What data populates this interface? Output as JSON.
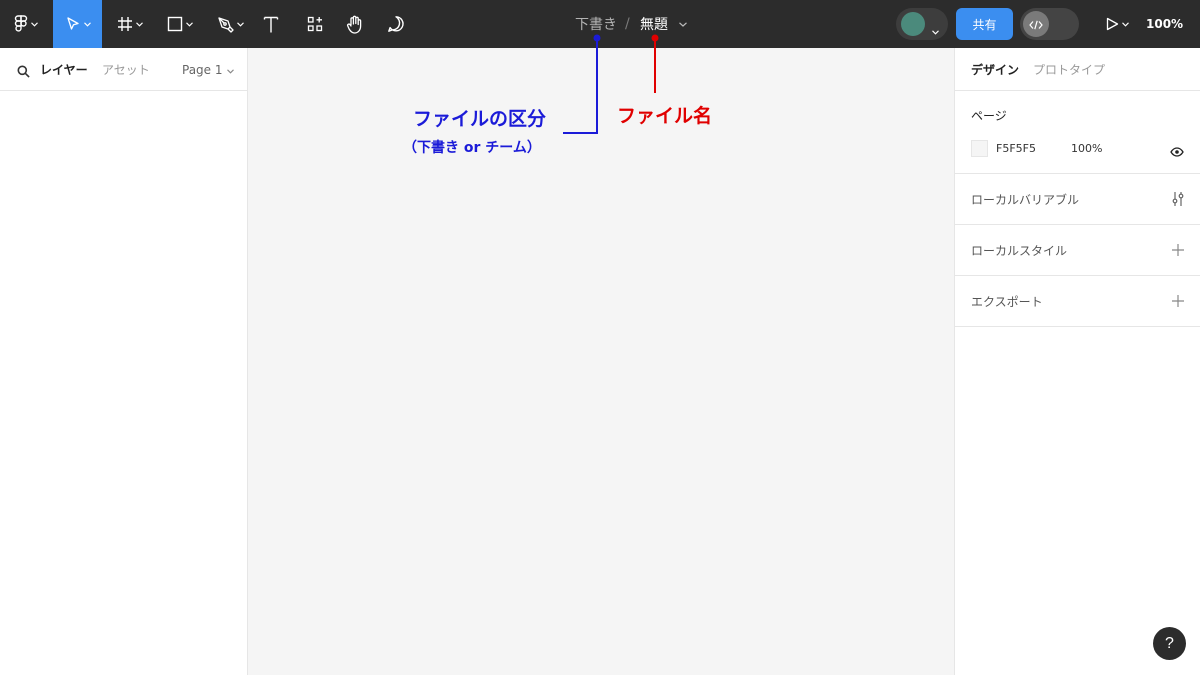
{
  "toolbar": {
    "breadcrumb_draft": "下書き",
    "breadcrumb_separator": "/",
    "file_name": "無題",
    "share_label": "共有",
    "zoom_label": "100%",
    "tool_icons": [
      "figma-menu-icon",
      "move-tool-icon",
      "frame-tool-icon",
      "rectangle-tool-icon",
      "pen-tool-icon",
      "text-tool-icon",
      "resources-icon",
      "hand-tool-icon",
      "comment-tool-icon",
      "code-icon",
      "present-icon"
    ],
    "accent_color": "#3b8ef0",
    "avatar_color": "#4b8a7c"
  },
  "left_panel": {
    "tab_layers": "レイヤー",
    "tab_assets": "アセット",
    "page_selector": "Page 1"
  },
  "right_panel": {
    "tab_design": "デザイン",
    "tab_prototype": "プロトタイプ",
    "page_section": {
      "title": "ページ",
      "color_hex": "F5F5F5",
      "opacity": "100%"
    },
    "local_variables": "ローカルバリアブル",
    "local_styles": "ローカルスタイル",
    "export": "エクスポート"
  },
  "help_label": "?",
  "annotations": {
    "file_type_title": "ファイルの区分",
    "file_type_sub": "（下書き or チーム）",
    "file_name_title": "ファイル名",
    "blue_color": "#1b1bd8",
    "red_color": "#e00000"
  }
}
